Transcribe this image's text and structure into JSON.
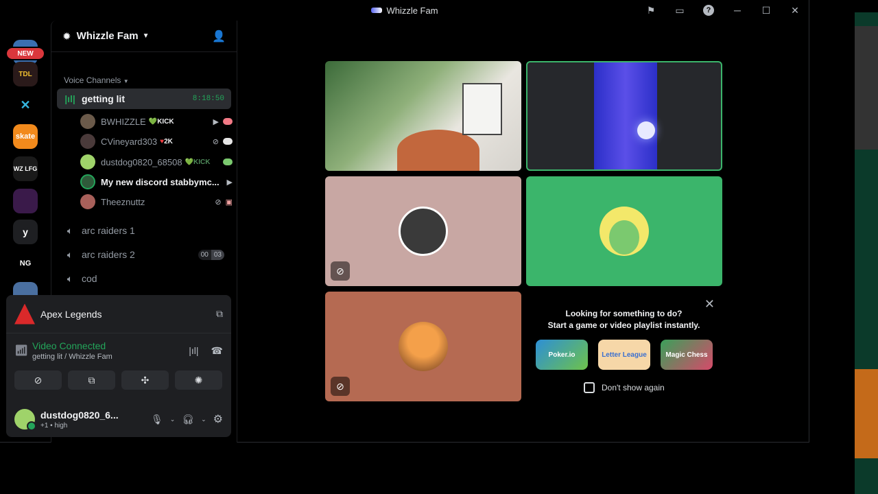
{
  "window": {
    "title": "Whizzle Fam"
  },
  "rail": {
    "new_badge": "NEW",
    "servers": [
      "TDL",
      "skate",
      "WZ LFG",
      "y",
      "NG"
    ]
  },
  "server": {
    "name": "Whizzle Fam",
    "category": "Voice Channels"
  },
  "channels": [
    {
      "name": "getting lit",
      "timer": "8:18:50",
      "active": true
    },
    {
      "name": "arc raiders 1"
    },
    {
      "name": "arc raiders 2",
      "count_a": "00",
      "count_b": "03"
    },
    {
      "name": "cod"
    }
  ],
  "members": [
    {
      "name": "BWHIZZLE",
      "tag": "KICK",
      "tag_color": "#23a55a"
    },
    {
      "name": "CVineyard303",
      "tag": "2K",
      "tag_color": "#f23f43"
    },
    {
      "name": "dustdog0820_68508",
      "tag": "KICK",
      "tag_color": "#23a55a"
    },
    {
      "name": "My new discord stabbymc..."
    },
    {
      "name": "Theeznuttz"
    }
  ],
  "panel": {
    "activity": "Apex Legends",
    "status": "Video Connected",
    "location": "getting lit / Whizzle Fam"
  },
  "user": {
    "name": "dustdog0820_6...",
    "status": "+1 • high"
  },
  "promo": {
    "line1": "Looking for something to do?",
    "line2": "Start a game or video playlist instantly.",
    "games": [
      "Poker.io",
      "Letter League",
      "Magic Chess"
    ],
    "checkbox_label": "Don't show again"
  },
  "colors": {
    "green": "#23a55a",
    "tile_pink": "#c8a7a3",
    "tile_green": "#3bb56b",
    "tile_brown": "#b56a52"
  }
}
